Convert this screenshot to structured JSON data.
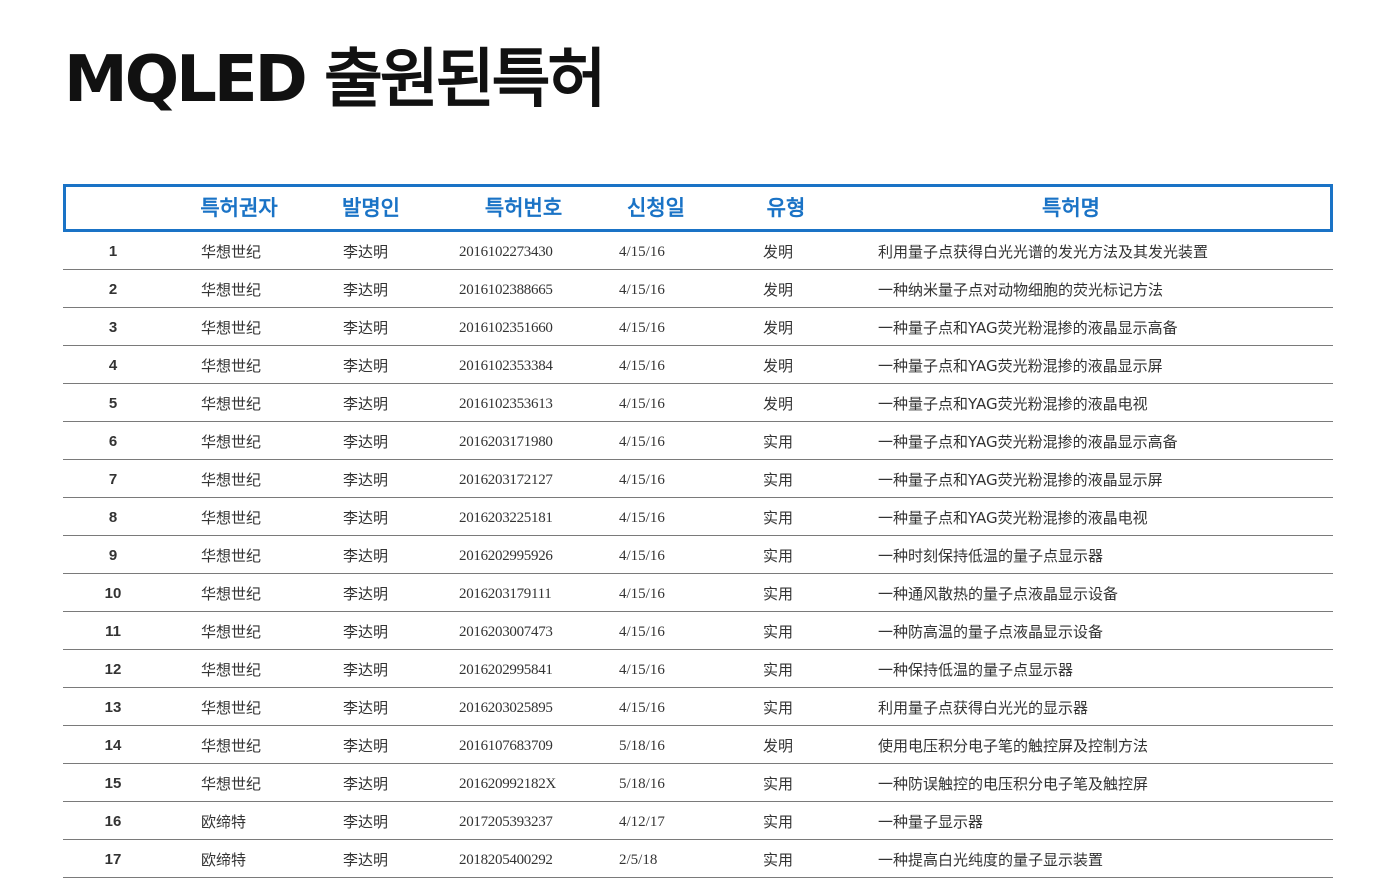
{
  "title": "MQLED 출원된특허",
  "table": {
    "headers": {
      "owner": "특허권자",
      "inventor": "발명인",
      "patent_no": "특허번호",
      "date": "신청일",
      "type": "유형",
      "name": "특허명"
    },
    "rows": [
      {
        "no": "1",
        "owner": "华想世纪",
        "inventor": "李达明",
        "patent_no": "2016102273430",
        "date": "4/15/16",
        "type": "发明",
        "name": "利用量子点获得白光光谱的发光方法及其发光装置"
      },
      {
        "no": "2",
        "owner": "华想世纪",
        "inventor": "李达明",
        "patent_no": "2016102388665",
        "date": "4/15/16",
        "type": "发明",
        "name": "一种纳米量子点对动物细胞的荧光标记方法"
      },
      {
        "no": "3",
        "owner": "华想世纪",
        "inventor": "李达明",
        "patent_no": "2016102351660",
        "date": "4/15/16",
        "type": "发明",
        "name": "一种量子点和YAG荧光粉混掺的液晶显示高备"
      },
      {
        "no": "4",
        "owner": "华想世纪",
        "inventor": "李达明",
        "patent_no": "2016102353384",
        "date": "4/15/16",
        "type": "发明",
        "name": "一种量子点和YAG荧光粉混掺的液晶显示屏"
      },
      {
        "no": "5",
        "owner": "华想世纪",
        "inventor": "李达明",
        "patent_no": "2016102353613",
        "date": "4/15/16",
        "type": "发明",
        "name": "一种量子点和YAG荧光粉混掺的液晶电视"
      },
      {
        "no": "6",
        "owner": "华想世纪",
        "inventor": "李达明",
        "patent_no": "2016203171980",
        "date": "4/15/16",
        "type": "实用",
        "name": "一种量子点和YAG荧光粉混掺的液晶显示高备"
      },
      {
        "no": "7",
        "owner": "华想世纪",
        "inventor": "李达明",
        "patent_no": "2016203172127",
        "date": "4/15/16",
        "type": "实用",
        "name": "一种量子点和YAG荧光粉混掺的液晶显示屏"
      },
      {
        "no": "8",
        "owner": "华想世纪",
        "inventor": "李达明",
        "patent_no": "2016203225181",
        "date": "4/15/16",
        "type": "实用",
        "name": "一种量子点和YAG荧光粉混掺的液晶电视"
      },
      {
        "no": "9",
        "owner": "华想世纪",
        "inventor": "李达明",
        "patent_no": "2016202995926",
        "date": "4/15/16",
        "type": "实用",
        "name": "一种时刻保持低温的量子点显示器"
      },
      {
        "no": "10",
        "owner": "华想世纪",
        "inventor": "李达明",
        "patent_no": "2016203179111",
        "date": "4/15/16",
        "type": "实用",
        "name": "一种通风散热的量子点液晶显示设备"
      },
      {
        "no": "11",
        "owner": "华想世纪",
        "inventor": "李达明",
        "patent_no": "2016203007473",
        "date": "4/15/16",
        "type": "实用",
        "name": "一种防高温的量子点液晶显示设备"
      },
      {
        "no": "12",
        "owner": "华想世纪",
        "inventor": "李达明",
        "patent_no": "2016202995841",
        "date": "4/15/16",
        "type": "实用",
        "name": "一种保持低温的量子点显示器"
      },
      {
        "no": "13",
        "owner": "华想世纪",
        "inventor": "李达明",
        "patent_no": "2016203025895",
        "date": "4/15/16",
        "type": "实用",
        "name": "利用量子点获得白光光的显示器"
      },
      {
        "no": "14",
        "owner": "华想世纪",
        "inventor": "李达明",
        "patent_no": "2016107683709",
        "date": "5/18/16",
        "type": "发明",
        "name": "使用电压积分电子笔的触控屏及控制方法"
      },
      {
        "no": "15",
        "owner": "华想世纪",
        "inventor": "李达明",
        "patent_no": "201620992182X",
        "date": "5/18/16",
        "type": "实用",
        "name": "一种防误触控的电压积分电子笔及触控屏"
      },
      {
        "no": "16",
        "owner": "欧缔特",
        "inventor": "李达明",
        "patent_no": "2017205393237",
        "date": "4/12/17",
        "type": "实用",
        "name": "一种量子显示器"
      },
      {
        "no": "17",
        "owner": "欧缔特",
        "inventor": "李达明",
        "patent_no": "2018205400292",
        "date": "2/5/18",
        "type": "实用",
        "name": "一种提高白光纯度的量子显示装置"
      }
    ]
  },
  "colors": {
    "accent": "#1a73c6",
    "text": "#333333",
    "rule": "#7a7a7a"
  }
}
